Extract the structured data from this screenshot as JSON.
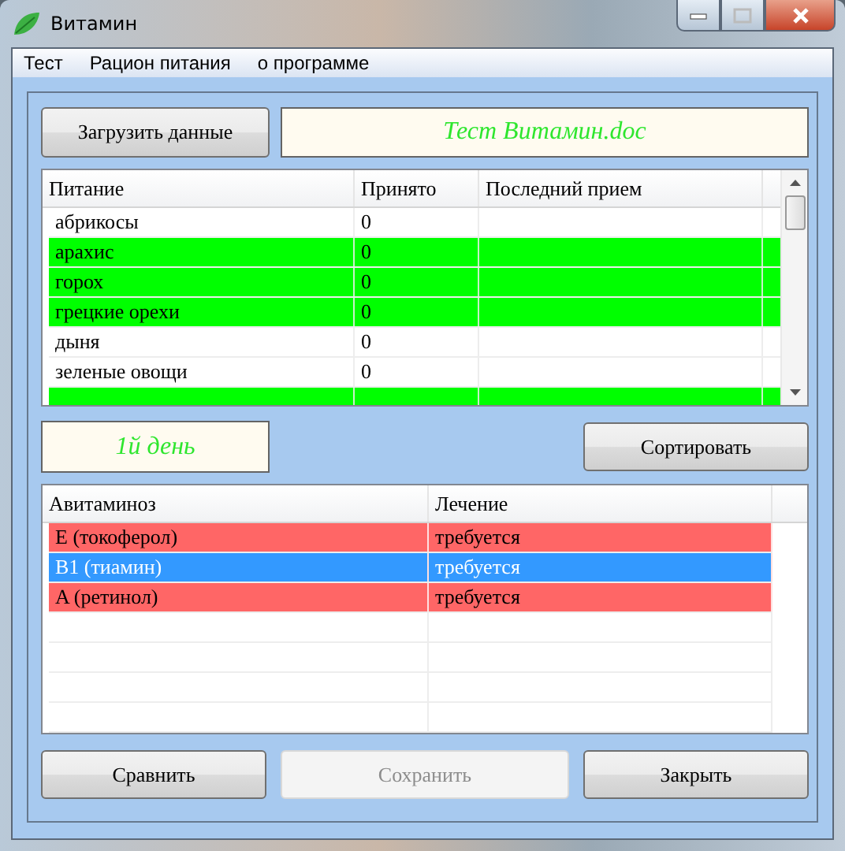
{
  "window": {
    "title": "Витамин"
  },
  "menu": [
    "Тест",
    "Рацион питания",
    "о программе"
  ],
  "load_button": {
    "label": "Загрузить данные"
  },
  "file_name": "Тест Витамин.doc",
  "foods": {
    "columns": [
      "Питание",
      "Принято",
      "Последний прием"
    ],
    "rows": [
      {
        "cells": [
          "абрикосы",
          "0",
          ""
        ],
        "highlighted": false
      },
      {
        "cells": [
          "арахис",
          "0",
          ""
        ],
        "highlighted": true
      },
      {
        "cells": [
          "горох",
          "0",
          ""
        ],
        "highlighted": true
      },
      {
        "cells": [
          "грецкие орехи",
          "0",
          ""
        ],
        "highlighted": true
      },
      {
        "cells": [
          "дыня",
          "0",
          ""
        ],
        "highlighted": false
      },
      {
        "cells": [
          "зеленые овощи",
          "0",
          ""
        ],
        "highlighted": false
      },
      {
        "cells": [
          "",
          "",
          ""
        ],
        "highlighted": true
      }
    ]
  },
  "day": "1й день",
  "sort_button": {
    "label": "Сортировать"
  },
  "deficiencies": {
    "columns": [
      "Авитаминоз",
      "Лечение"
    ],
    "rows": [
      {
        "cells": [
          "E (токоферол)",
          "требуется"
        ],
        "selected": false
      },
      {
        "cells": [
          "B1 (тиамин)",
          "требуется"
        ],
        "selected": true
      },
      {
        "cells": [
          "A (ретинол)",
          "требуется"
        ],
        "selected": false
      }
    ]
  },
  "buttons": [
    {
      "label": "Сравнить",
      "disabled": false
    },
    {
      "label": "Сохранить",
      "disabled": true
    },
    {
      "label": "Закрыть",
      "disabled": false
    }
  ]
}
